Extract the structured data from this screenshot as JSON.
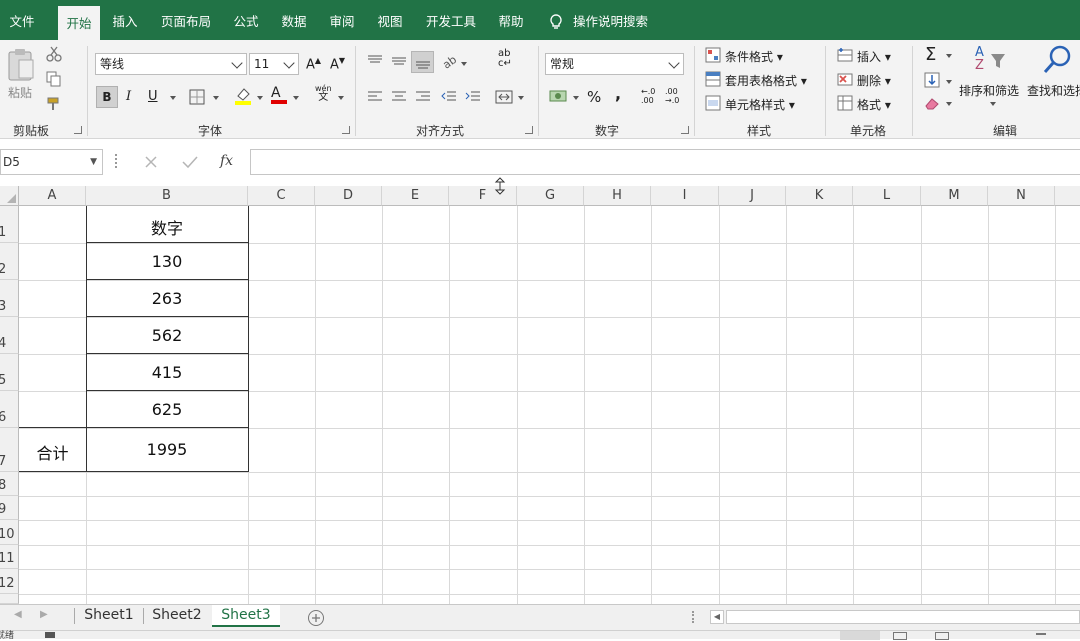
{
  "ribbon_tabs": [
    "文件",
    "开始",
    "插入",
    "页面布局",
    "公式",
    "数据",
    "审阅",
    "视图",
    "开发工具",
    "帮助"
  ],
  "tell_me": "操作说明搜索",
  "clipboard": {
    "paste": "粘贴",
    "group": "剪贴板"
  },
  "font": {
    "name": "等线",
    "size": "11",
    "grow": "A",
    "shrink": "A",
    "bold": "B",
    "italic": "I",
    "underline": "U",
    "phonetic_top": "wén",
    "phonetic_bottom": "文",
    "group": "字体",
    "font_color": "A"
  },
  "alignment": {
    "wrap_top": "ab",
    "wrap_bottom": "c",
    "group": "对齐方式"
  },
  "number": {
    "format": "常规",
    "percent": "%",
    "comma": ",",
    "inc_decimal": "←.0",
    "inc_decimal2": ".00",
    "dec_decimal": ".00",
    "dec_decimal2": "→.0",
    "group": "数字"
  },
  "styles": {
    "conditional": "条件格式",
    "table": "套用表格格式",
    "cell": "单元格样式",
    "group": "样式"
  },
  "cells": {
    "insert": "插入",
    "delete": "删除",
    "format": "格式",
    "group": "单元格"
  },
  "editing": {
    "sum": "Σ",
    "sort_top": "A",
    "sort_bottom": "Z",
    "sort": "排序和筛选",
    "find": "查找和选择",
    "group": "编辑"
  },
  "formula_bar": {
    "name_box": "D5",
    "fx": "fx",
    "value": ""
  },
  "columns": [
    "A",
    "B",
    "C",
    "D",
    "E",
    "F",
    "G",
    "H",
    "I",
    "J",
    "K",
    "L",
    "M",
    "N"
  ],
  "rows": [
    "1",
    "2",
    "3",
    "4",
    "5",
    "6",
    "7",
    "8",
    "9",
    "10",
    "11",
    "12"
  ],
  "cells_data": {
    "B1": "数字",
    "B2": "130",
    "B3": "263",
    "B4": "562",
    "B5": "415",
    "B6": "625",
    "A7": "合计",
    "B7": "1995"
  },
  "sheets": [
    "Sheet1",
    "Sheet2",
    "Sheet3"
  ],
  "active_sheet": "Sheet3",
  "status": "就绪",
  "colors": {
    "accent": "#217346",
    "ribbon": "#f3f3f3"
  }
}
